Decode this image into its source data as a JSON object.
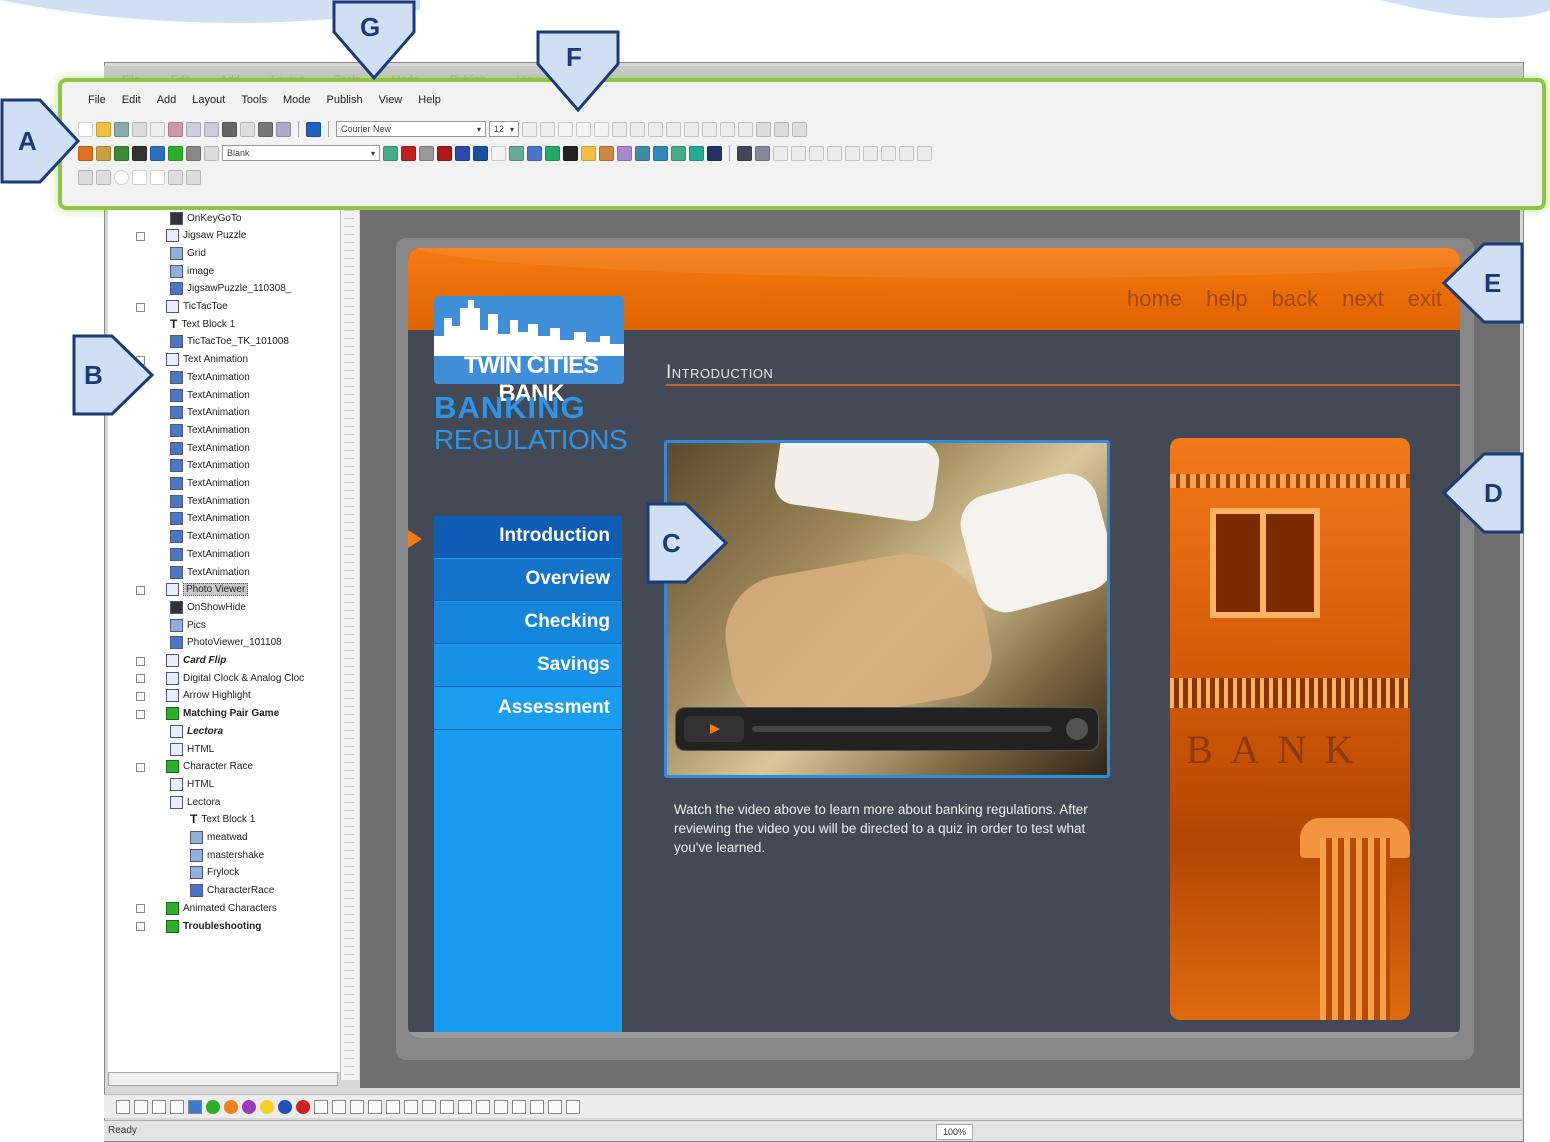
{
  "menubar": [
    "File",
    "Edit",
    "Add",
    "Layout",
    "Tools",
    "Mode",
    "Publish",
    "View",
    "Help"
  ],
  "ghost_menubar": "File  Edit  Add  Layout  Tools  Mode  Publish  View  Help",
  "toolbar": {
    "font_name": "Courier New",
    "font_size": "12",
    "style_combo": "Blank"
  },
  "tree": [
    {
      "label": "OnKeyGoTo",
      "icon": "action",
      "level": 3
    },
    {
      "label": "Jigsaw Puzzle",
      "icon": "page",
      "level": 2
    },
    {
      "label": "Grid",
      "icon": "image",
      "level": 3
    },
    {
      "label": "image",
      "icon": "image",
      "level": 3
    },
    {
      "label": "JigsawPuzzle_110308_",
      "icon": "anim",
      "level": 3
    },
    {
      "label": "TicTacToe",
      "icon": "page",
      "level": 2
    },
    {
      "label": "Text Block 1",
      "icon": "text",
      "level": 3
    },
    {
      "label": "TicTacToe_TK_101008",
      "icon": "anim",
      "level": 3
    },
    {
      "label": "Text Animation",
      "icon": "page",
      "level": 2
    },
    {
      "label": "TextAnimation",
      "icon": "anim",
      "level": 3
    },
    {
      "label": "TextAnimation",
      "icon": "anim",
      "level": 3
    },
    {
      "label": "TextAnimation",
      "icon": "anim",
      "level": 3
    },
    {
      "label": "TextAnimation",
      "icon": "anim",
      "level": 3
    },
    {
      "label": "TextAnimation",
      "icon": "anim",
      "level": 3
    },
    {
      "label": "TextAnimation",
      "icon": "anim",
      "level": 3
    },
    {
      "label": "TextAnimation",
      "icon": "anim",
      "level": 3
    },
    {
      "label": "TextAnimation",
      "icon": "anim",
      "level": 3
    },
    {
      "label": "TextAnimation",
      "icon": "anim",
      "level": 3
    },
    {
      "label": "TextAnimation",
      "icon": "anim",
      "level": 3
    },
    {
      "label": "TextAnimation",
      "icon": "anim",
      "level": 3
    },
    {
      "label": "TextAnimation",
      "icon": "anim",
      "level": 3
    },
    {
      "label": "Photo Viewer",
      "icon": "page",
      "level": 2,
      "selected": true
    },
    {
      "label": "OnShowHide",
      "icon": "action",
      "level": 3
    },
    {
      "label": "Pics",
      "icon": "image",
      "level": 3
    },
    {
      "label": "PhotoViewer_101108",
      "icon": "anim",
      "level": 3
    },
    {
      "label": "Card Flip",
      "icon": "page",
      "level": 2,
      "italic": true
    },
    {
      "label": "Digital Clock & Analog Cloc",
      "icon": "page",
      "level": 2
    },
    {
      "label": "Arrow Highlight",
      "icon": "page",
      "level": 2
    },
    {
      "label": "Matching Pair Game",
      "icon": "chapter",
      "level": 2,
      "bold": true
    },
    {
      "label": "Lectora",
      "icon": "page",
      "level": 3,
      "italic": true
    },
    {
      "label": "HTML",
      "icon": "page",
      "level": 3
    },
    {
      "label": "Character Race",
      "icon": "chapter",
      "level": 2
    },
    {
      "label": "HTML",
      "icon": "page",
      "level": 3
    },
    {
      "label": "Lectora",
      "icon": "page",
      "level": 3
    },
    {
      "label": "Text Block 1",
      "icon": "text",
      "level": 4
    },
    {
      "label": "meatwad",
      "icon": "image",
      "level": 4
    },
    {
      "label": "mastershake",
      "icon": "image",
      "level": 4
    },
    {
      "label": "Frylock",
      "icon": "image",
      "level": 4
    },
    {
      "label": "CharacterRace",
      "icon": "anim",
      "level": 4
    },
    {
      "label": "Animated Characters",
      "icon": "chapter",
      "level": 2
    },
    {
      "label": "Troubleshooting",
      "icon": "chapter",
      "level": 2,
      "bold": true
    }
  ],
  "course": {
    "nav_links": [
      "home",
      "help",
      "back",
      "next",
      "exit"
    ],
    "logo_name": "TWIN CITIES BANK",
    "logo_banking": "BANKING",
    "logo_regulations": "REGULATIONS",
    "section_title": "Introduction",
    "menu": [
      "Introduction",
      "Overview",
      "Checking",
      "Savings",
      "Assessment"
    ],
    "active_menu": "Introduction",
    "body_text": "Watch the video above to learn more about banking regulations. After reviewing the video you will be directed to a quiz in order to test what you've learned.",
    "bank_sign": "BANK"
  },
  "status": {
    "ready": "Ready",
    "zoom": "100%"
  },
  "callouts": [
    "A",
    "B",
    "C",
    "D",
    "E",
    "F",
    "G"
  ],
  "colors": {
    "highlight_green": "#8dc63f",
    "course_orange": "#f57a12",
    "course_blue": "#1a9cf0",
    "callout_navy": "#1b3a7a"
  }
}
